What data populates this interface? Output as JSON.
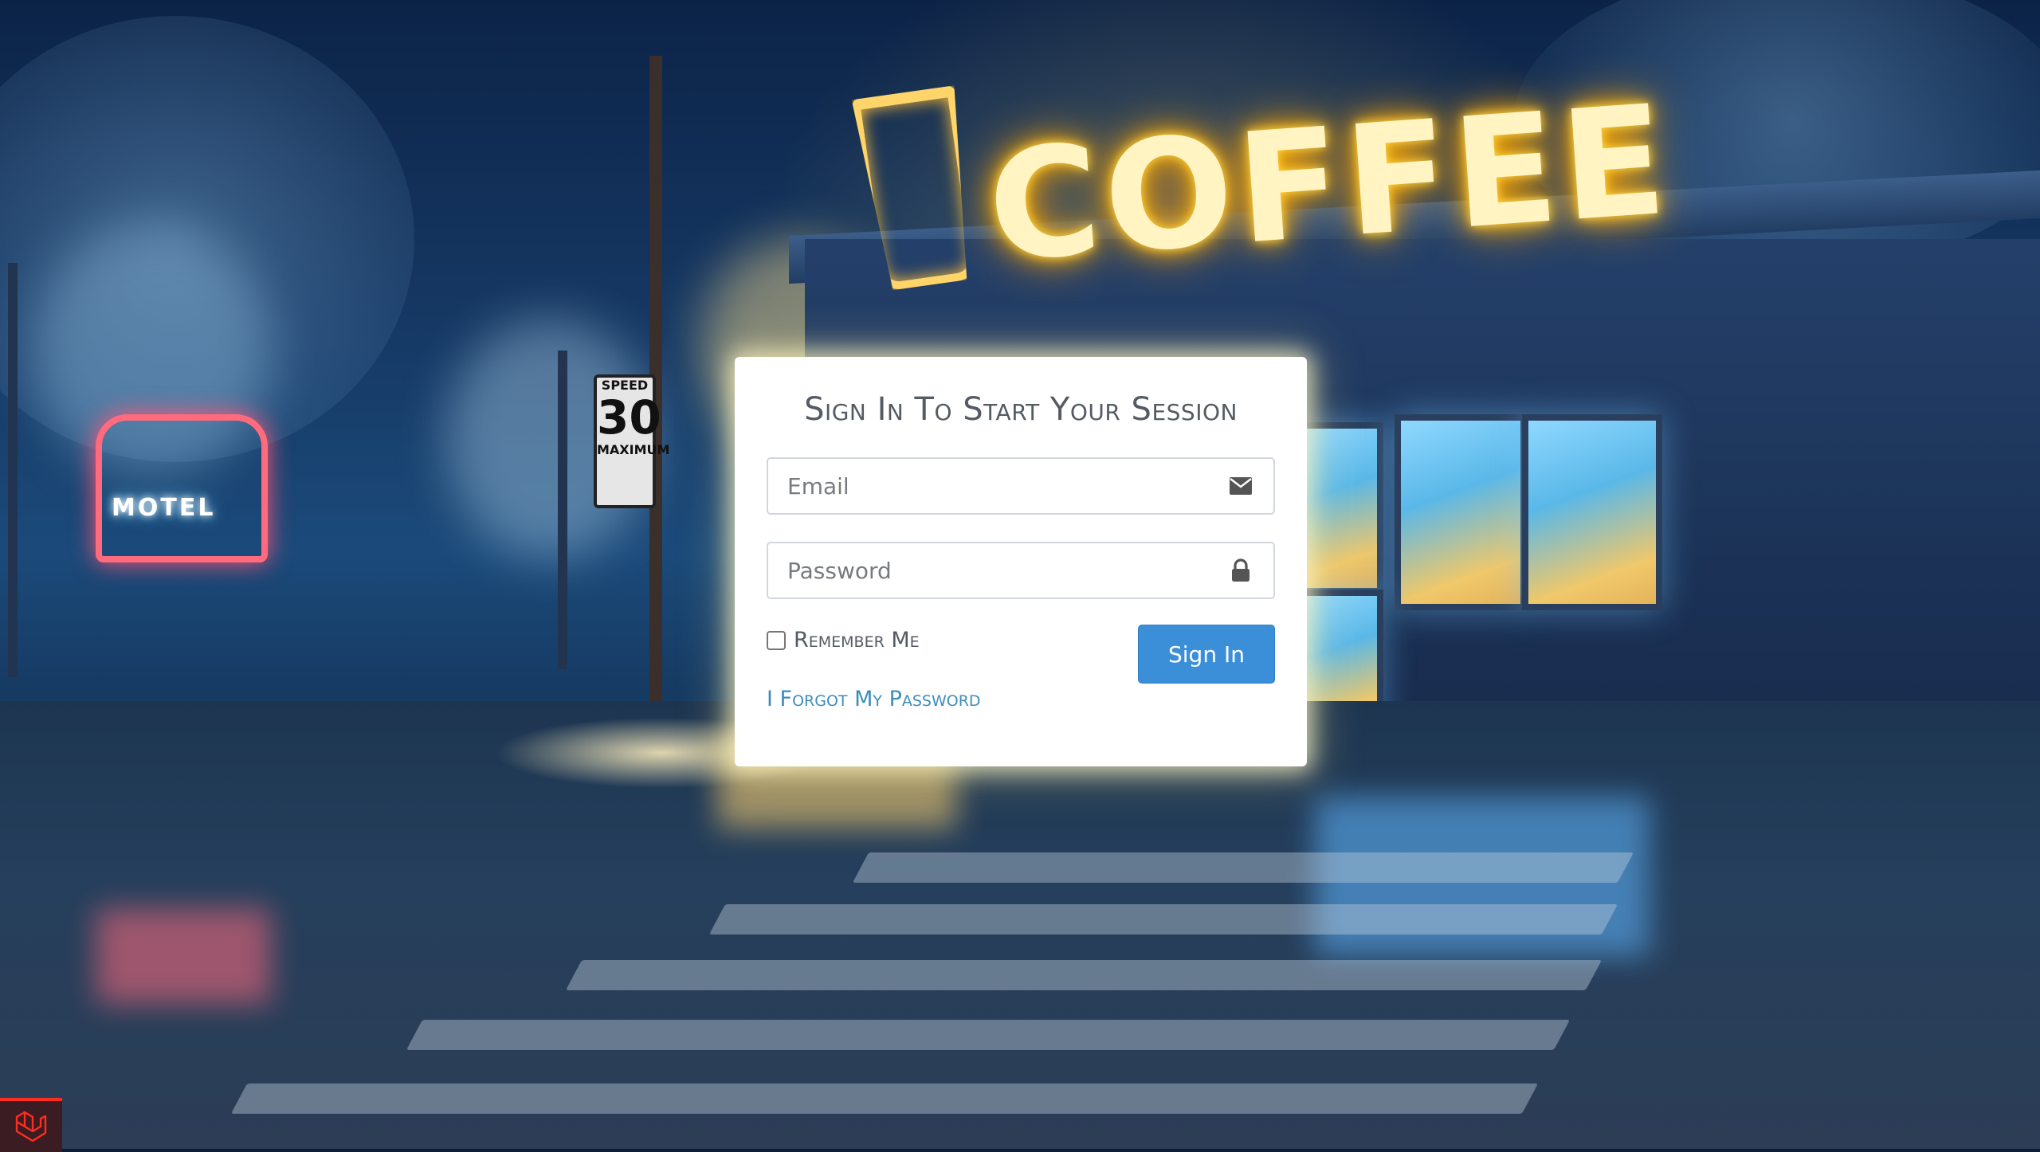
{
  "login": {
    "title": "Sign In To Start Your Session",
    "email_placeholder": "Email",
    "password_placeholder": "Password",
    "remember_label": "Remember Me",
    "remember_checked": false,
    "signin_label": "Sign In",
    "forgot_label": "I Forgot My Password"
  },
  "icons": {
    "email": "envelope-icon",
    "password": "lock-icon",
    "corner": "laravel-logo-icon"
  },
  "colors": {
    "primary_button": "#3b8fd8",
    "link": "#3c8dbc",
    "card_bg": "#ffffff",
    "title_text": "#555b63",
    "corner_accent": "#ff2d20"
  }
}
